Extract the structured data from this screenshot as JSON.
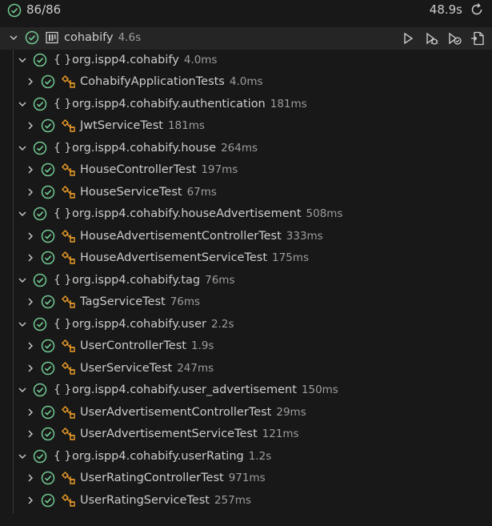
{
  "summary": {
    "passed_count": "86/86",
    "elapsed": "48.9s"
  },
  "root": {
    "name": "cohabify",
    "duration": "4.6s"
  },
  "packages": [
    {
      "name": "org.ispp4.cohabify",
      "duration": "4.0ms",
      "classes": [
        {
          "name": "CohabifyApplicationTests",
          "duration": "4.0ms"
        }
      ]
    },
    {
      "name": "org.ispp4.cohabify.authentication",
      "duration": "181ms",
      "classes": [
        {
          "name": "JwtServiceTest",
          "duration": "181ms"
        }
      ]
    },
    {
      "name": "org.ispp4.cohabify.house",
      "duration": "264ms",
      "classes": [
        {
          "name": "HouseControllerTest",
          "duration": "197ms"
        },
        {
          "name": "HouseServiceTest",
          "duration": "67ms"
        }
      ]
    },
    {
      "name": "org.ispp4.cohabify.houseAdvertisement",
      "duration": "508ms",
      "classes": [
        {
          "name": "HouseAdvertisementControllerTest",
          "duration": "333ms"
        },
        {
          "name": "HouseAdvertisementServiceTest",
          "duration": "175ms"
        }
      ]
    },
    {
      "name": "org.ispp4.cohabify.tag",
      "duration": "76ms",
      "classes": [
        {
          "name": "TagServiceTest",
          "duration": "76ms"
        }
      ]
    },
    {
      "name": "org.ispp4.cohabify.user",
      "duration": "2.2s",
      "classes": [
        {
          "name": "UserControllerTest",
          "duration": "1.9s"
        },
        {
          "name": "UserServiceTest",
          "duration": "247ms"
        }
      ]
    },
    {
      "name": "org.ispp4.cohabify.user_advertisement",
      "duration": "150ms",
      "classes": [
        {
          "name": "UserAdvertisementControllerTest",
          "duration": "29ms"
        },
        {
          "name": "UserAdvertisementServiceTest",
          "duration": "121ms"
        }
      ]
    },
    {
      "name": "org.ispp4.cohabify.userRating",
      "duration": "1.2s",
      "classes": [
        {
          "name": "UserRatingControllerTest",
          "duration": "971ms"
        },
        {
          "name": "UserRatingServiceTest",
          "duration": "257ms"
        }
      ]
    }
  ],
  "colors": {
    "pass": "#73c991",
    "class_icon": "#ee9d28",
    "text": "#cccccc",
    "muted": "#9d9d9d"
  }
}
